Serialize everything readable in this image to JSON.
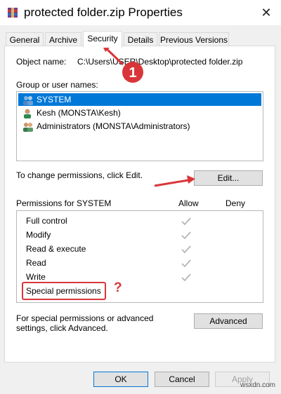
{
  "window": {
    "title": "protected folder.zip Properties",
    "close_glyph": "✕"
  },
  "tabs": [
    {
      "label": "General"
    },
    {
      "label": "Archive"
    },
    {
      "label": "Security"
    },
    {
      "label": "Details"
    },
    {
      "label": "Previous Versions"
    }
  ],
  "security": {
    "object_name_label": "Object name:",
    "object_name_value": "C:\\Users\\USER\\Desktop\\protected folder.zip",
    "groups_label": "Group or user names:",
    "groups": [
      {
        "name": "SYSTEM",
        "selected": true,
        "icon": "group-icon"
      },
      {
        "name": "Kesh (MONSTA\\Kesh)",
        "selected": false,
        "icon": "user-icon"
      },
      {
        "name": "Administrators (MONSTA\\Administrators)",
        "selected": false,
        "icon": "group-icon"
      }
    ],
    "change_text": "To change permissions, click Edit.",
    "edit_label": "Edit...",
    "perm_header": "Permissions for SYSTEM",
    "allow_header": "Allow",
    "deny_header": "Deny",
    "permissions": [
      {
        "name": "Full control",
        "allow": true
      },
      {
        "name": "Modify",
        "allow": true
      },
      {
        "name": "Read & execute",
        "allow": true
      },
      {
        "name": "Read",
        "allow": true
      },
      {
        "name": "Write",
        "allow": true
      },
      {
        "name": "Special permissions",
        "allow": false
      }
    ],
    "special_text": "For special permissions or advanced settings, click Advanced.",
    "advanced_label": "Advanced"
  },
  "buttons": {
    "ok": "OK",
    "cancel": "Cancel",
    "apply": "Apply"
  },
  "annotations": {
    "step_number": "1",
    "question_mark": "?",
    "accent_color": "#d9363a"
  },
  "watermark": "wsxdn.com"
}
